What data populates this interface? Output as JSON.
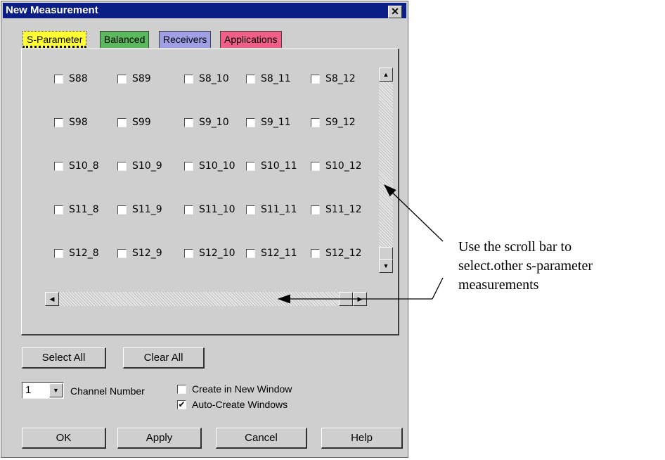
{
  "dialog": {
    "title": "New Measurement",
    "close_symbol": "✕"
  },
  "tabs": [
    {
      "label": "S-Parameter",
      "color": "#ffff33"
    },
    {
      "label": "Balanced",
      "color": "#5cb85c"
    },
    {
      "label": "Receivers",
      "color": "#9f9fe6"
    },
    {
      "label": "Applications",
      "color": "#ef5f88"
    }
  ],
  "params": [
    [
      "S88",
      "S89",
      "S8_10",
      "S8_11",
      "S8_12"
    ],
    [
      "S98",
      "S99",
      "S9_10",
      "S9_11",
      "S9_12"
    ],
    [
      "S10_8",
      "S10_9",
      "S10_10",
      "S10_11",
      "S10_12"
    ],
    [
      "S11_8",
      "S11_9",
      "S11_10",
      "S11_11",
      "S11_12"
    ],
    [
      "S12_8",
      "S12_9",
      "S12_10",
      "S12_11",
      "S12_12"
    ]
  ],
  "scroll": {
    "up": "▲",
    "down": "▼",
    "left": "◀",
    "right": "▶"
  },
  "buttons": {
    "select_all": "Select All",
    "clear_all": "Clear All",
    "ok": "OK",
    "apply": "Apply",
    "cancel": "Cancel",
    "help": "Help"
  },
  "channel": {
    "value": "1",
    "label": "Channel Number",
    "arrow": "▼"
  },
  "options": {
    "create_new_window": {
      "label": "Create in New Window",
      "checked": false
    },
    "auto_create": {
      "label": "Auto-Create Windows",
      "checked": true,
      "mark": "✔"
    }
  },
  "annotation": [
    "Use the scroll bar to",
    "select.other s-parameter",
    "measurements"
  ],
  "colors": {
    "title_bar": "#0a1e86",
    "dialog_bg": "#cfcfcf"
  }
}
